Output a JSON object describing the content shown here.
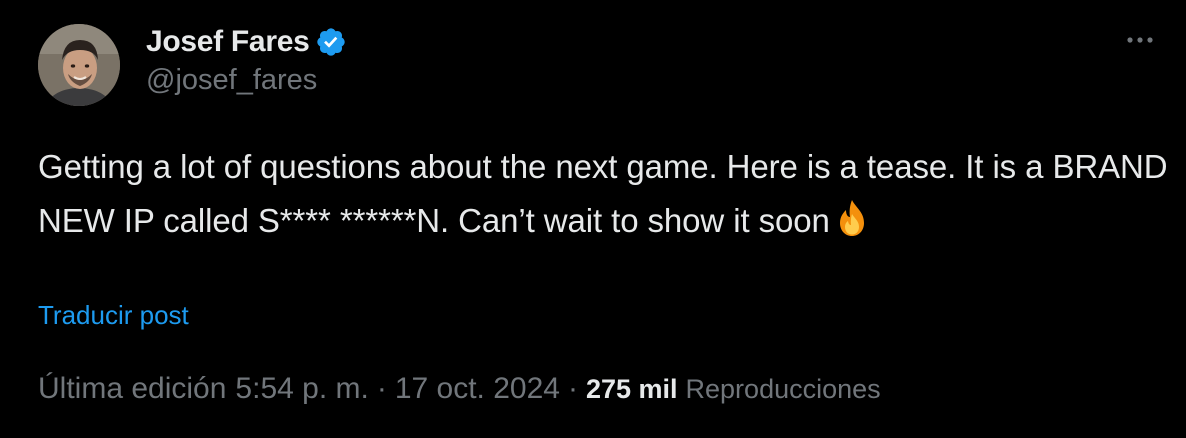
{
  "author": {
    "display_name": "Josef Fares",
    "handle": "@josef_fares",
    "verified_icon": "verified-badge-icon",
    "avatar_icon": "avatar"
  },
  "tweet": {
    "text": "Getting a lot of questions about the next game. Here is a tease. It is a BRAND NEW IP called S**** ******N. Can’t wait to show it soon",
    "emoji": "🔥",
    "translate_label": "Traducir post"
  },
  "meta": {
    "edited_label": "Última edición",
    "time": "5:54 p. m.",
    "separator": "·",
    "date": "17 oct. 2024",
    "views_count": "275 mil",
    "views_label": "Reproducciones"
  },
  "colors": {
    "background": "#000000",
    "text": "#e7e9ea",
    "muted": "#71767b",
    "link": "#1d9bf0",
    "verified": "#1d9bf0"
  },
  "icons": {
    "more": "more-options-icon",
    "emoji": "fire-emoji-icon"
  }
}
